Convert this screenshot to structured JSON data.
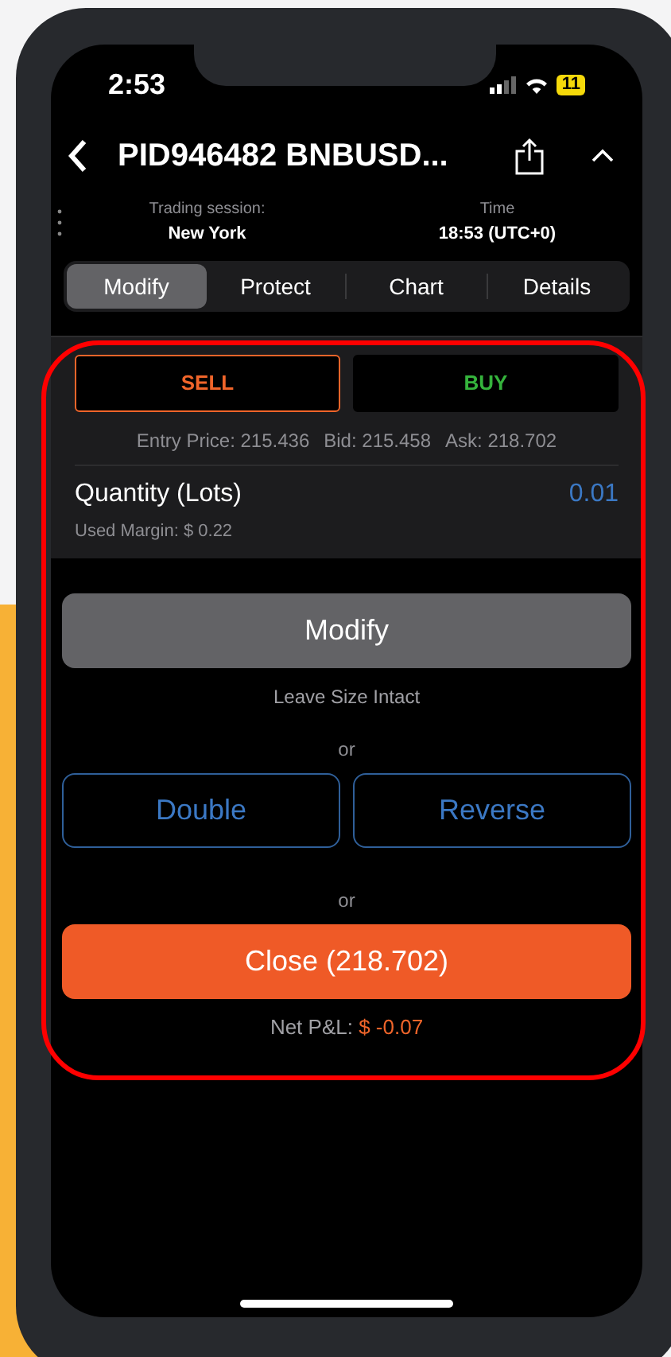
{
  "status_bar": {
    "time": "2:53",
    "battery": "11"
  },
  "header": {
    "title": "PID946482 BNBUSD..."
  },
  "info": [
    {
      "label": "Trading session:",
      "value": "New York"
    },
    {
      "label": "Time",
      "value": "18:53 (UTC+0)"
    }
  ],
  "tabs": [
    {
      "label": "Modify",
      "selected": true
    },
    {
      "label": "Protect",
      "selected": false
    },
    {
      "label": "Chart",
      "selected": false
    },
    {
      "label": "Details",
      "selected": false
    }
  ],
  "sides": [
    {
      "label": "SELL",
      "selected": true,
      "kind": "sell"
    },
    {
      "label": "BUY",
      "selected": false,
      "kind": "buy"
    }
  ],
  "prices": [
    "Entry Price: 215.436",
    "Bid: 215.458",
    "Ask: 218.702"
  ],
  "quantity": {
    "label": "Quantity (Lots)",
    "value": "0.01",
    "margin": "Used Margin: $ 0.22"
  },
  "modify": {
    "label": "Modify",
    "hint": "Leave Size Intact"
  },
  "separators": [
    "or",
    "or"
  ],
  "alternatives": [
    "Double",
    "Reverse"
  ],
  "close": {
    "label": "Close (218.702)"
  },
  "pnl": {
    "label": "Net P&L:",
    "value": "$ -0.07"
  }
}
